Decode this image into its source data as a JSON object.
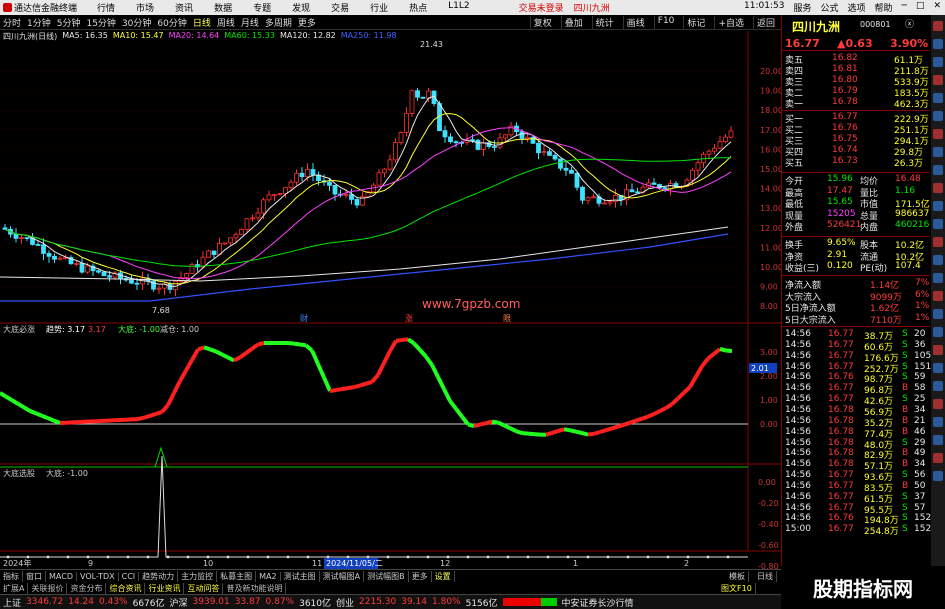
{
  "app": {
    "title": "通达信金融终端",
    "menu": [
      "行情",
      "市场",
      "资讯",
      "数据",
      "专题",
      "发现",
      "交易",
      "行业",
      "热点",
      "L1L2"
    ],
    "warning": "交易未登录",
    "stock_tab": "四川九洲",
    "time": "11:01:53",
    "right_menu": [
      "服务",
      "公式",
      "选项",
      "帮助"
    ]
  },
  "toolbar": {
    "periods": [
      "分时",
      "1分钟",
      "5分钟",
      "15分钟",
      "30分钟",
      "60分钟",
      "日线",
      "周线",
      "月线",
      "多周期",
      "更多"
    ],
    "active": "日线",
    "right": [
      "复权",
      "叠加",
      "统计",
      "画线",
      "F10",
      "标记",
      "+自选",
      "返回"
    ]
  },
  "chart_header": {
    "name": "四川九洲(日线)",
    "ma": [
      {
        "label": "MA5: 16.35",
        "color": "#e8e8e8"
      },
      {
        "label": "MA10: 15.47",
        "color": "#ffff33"
      },
      {
        "label": "MA20: 14.64",
        "color": "#ff40ff"
      },
      {
        "label": "MA60: 15.33",
        "color": "#00e600"
      },
      {
        "label": "MA120: 12.82",
        "color": "#e8e8e8"
      },
      {
        "label": "MA250: 11.98",
        "color": "#4060ff"
      }
    ]
  },
  "watermark_site": "www.7gpzb.com",
  "watermark_brand": "股期指标网",
  "price_axis": [
    "20.00",
    "19.00",
    "18.00",
    "17.00",
    "16.00",
    "15.00",
    "14.00",
    "13.00",
    "12.00",
    "11.00",
    "10.00",
    "9.00",
    "8.00"
  ],
  "price_marks": {
    "high": "21.43",
    "low": "7.68"
  },
  "event_labels": [
    "财",
    "涨",
    "限"
  ],
  "ind1": {
    "title": "大底必涨",
    "l1": "趋势: 3.17",
    "l1b": "3.17",
    "l2": "大底: -1.00",
    "l3": "减仓: 1.00",
    "axis": [
      "3.00",
      "2.00",
      "1.00",
      "0.00"
    ],
    "badge": "2.01"
  },
  "ind2": {
    "title": "大底选股",
    "l1": "大底: -1.00",
    "axis": [
      "0.00",
      "-0.20",
      "-0.40",
      "-0.60",
      "-0.80"
    ]
  },
  "date_axis": [
    "2024年",
    "9",
    "10",
    "11",
    "2024/11/05/二",
    "12",
    "1",
    "2"
  ],
  "quote": {
    "name": "四川九洲",
    "code": "000801",
    "price": "16.77",
    "change": "▲0.63",
    "pct": "3.90%",
    "ask": [
      {
        "l": "卖五",
        "p": "16.82",
        "v": "61.1万"
      },
      {
        "l": "卖四",
        "p": "16.81",
        "v": "211.8万"
      },
      {
        "l": "卖三",
        "p": "16.80",
        "v": "533.9万"
      },
      {
        "l": "卖二",
        "p": "16.79",
        "v": "183.5万"
      },
      {
        "l": "卖一",
        "p": "16.78",
        "v": "462.3万"
      }
    ],
    "bid": [
      {
        "l": "买一",
        "p": "16.77",
        "v": "222.9万"
      },
      {
        "l": "买二",
        "p": "16.76",
        "v": "251.1万"
      },
      {
        "l": "买三",
        "p": "16.75",
        "v": "294.1万"
      },
      {
        "l": "买四",
        "p": "16.74",
        "v": "29.8万"
      },
      {
        "l": "买五",
        "p": "16.73",
        "v": "26.3万"
      }
    ],
    "stats": [
      {
        "a": "今开",
        "av": "15.96",
        "b": "均价",
        "bv": "16.48"
      },
      {
        "a": "最高",
        "av": "17.47",
        "b": "量比",
        "bv": "1.16"
      },
      {
        "a": "最低",
        "av": "15.65",
        "b": "市值",
        "bv": "171.5亿"
      },
      {
        "a": "现量",
        "av": "15205",
        "b": "总量",
        "bv": "986637"
      },
      {
        "a": "外盘",
        "av": "526421",
        "b": "内盘",
        "bv": "460216"
      }
    ],
    "stats2": [
      {
        "a": "换手",
        "av": "9.65%",
        "b": "股本",
        "bv": "10.2亿"
      },
      {
        "a": "净资",
        "av": "2.91",
        "b": "流通",
        "bv": "10.2亿"
      },
      {
        "a": "收益(三)",
        "av": "0.120",
        "b": "PE(动)",
        "bv": "107.4"
      }
    ],
    "flows": [
      {
        "l": "净流入额",
        "v": "1.14亿",
        "p": "7%"
      },
      {
        "l": "大宗流入",
        "v": "9099万",
        "p": "6%"
      },
      {
        "l": "5日净流入额",
        "v": "1.62亿",
        "p": "1%"
      },
      {
        "l": "5日大宗流入",
        "v": "7110万",
        "p": "1%"
      }
    ],
    "ticks": [
      {
        "t": "14:56",
        "p": "16.77",
        "v": "38.7万",
        "s": "S",
        "n": "20"
      },
      {
        "t": "14:56",
        "p": "16.77",
        "v": "60.6万",
        "s": "S",
        "n": "36"
      },
      {
        "t": "14:56",
        "p": "16.77",
        "v": "176.6万",
        "s": "S",
        "n": "105"
      },
      {
        "t": "14:56",
        "p": "16.77",
        "v": "252.7万",
        "s": "S",
        "n": "151"
      },
      {
        "t": "14:56",
        "p": "16.76",
        "v": "98.7万",
        "s": "S",
        "n": "59"
      },
      {
        "t": "14:56",
        "p": "16.77",
        "v": "96.8万",
        "s": "B",
        "n": "58"
      },
      {
        "t": "14:56",
        "p": "16.77",
        "v": "42.6万",
        "s": "S",
        "n": "25"
      },
      {
        "t": "14:56",
        "p": "16.78",
        "v": "56.9万",
        "s": "B",
        "n": "34"
      },
      {
        "t": "14:56",
        "p": "16.78",
        "v": "35.2万",
        "s": "B",
        "n": "21"
      },
      {
        "t": "14:56",
        "p": "16.78",
        "v": "77.4万",
        "s": "B",
        "n": "46"
      },
      {
        "t": "14:56",
        "p": "16.78",
        "v": "48.0万",
        "s": "S",
        "n": "29"
      },
      {
        "t": "14:56",
        "p": "16.78",
        "v": "82.9万",
        "s": "B",
        "n": "49"
      },
      {
        "t": "14:56",
        "p": "16.78",
        "v": "57.1万",
        "s": "B",
        "n": "34"
      },
      {
        "t": "14:56",
        "p": "16.77",
        "v": "93.6万",
        "s": "S",
        "n": "56"
      },
      {
        "t": "14:56",
        "p": "16.77",
        "v": "83.5万",
        "s": "B",
        "n": "50"
      },
      {
        "t": "14:56",
        "p": "16.77",
        "v": "61.5万",
        "s": "S",
        "n": "37"
      },
      {
        "t": "14:56",
        "p": "16.77",
        "v": "95.5万",
        "s": "S",
        "n": "57"
      },
      {
        "t": "14:56",
        "p": "16.76",
        "v": "194.8万",
        "s": "S",
        "n": "152"
      },
      {
        "t": "15:00",
        "p": "16.77",
        "v": "254.8万",
        "s": "S",
        "n": "152"
      }
    ]
  },
  "bottom_tabs": [
    "指标",
    "窗口",
    "MACD",
    "VOL-TDX",
    "CCI",
    "趋势动力",
    "主力监控",
    "私募主图",
    "MA2",
    "测试主图",
    "测试幅图A",
    "测试幅图B",
    "更多",
    "设置"
  ],
  "bottom_right": [
    "模板",
    "日线"
  ],
  "tabs2": [
    "扩展A",
    "关联报价",
    "资金分布",
    "综合资讯",
    "行业资讯",
    "互动问答",
    "普及新功能说明"
  ],
  "tabs2_right": "图文F10 ",
  "status": {
    "sh": {
      "n": "上证",
      "v": "3346.72",
      "c": "14.24",
      "p": "0.43%",
      "a": "6676亿"
    },
    "sz": {
      "n": "沪深",
      "v": "3939.01",
      "c": "33.87",
      "p": "0.87%",
      "a": "3610亿"
    },
    "cy": {
      "n": "创业",
      "v": "2215.30",
      "c": "39.14",
      "p": "1.80%",
      "a": "5156亿"
    },
    "broker": "中安证券长沙行情"
  }
}
